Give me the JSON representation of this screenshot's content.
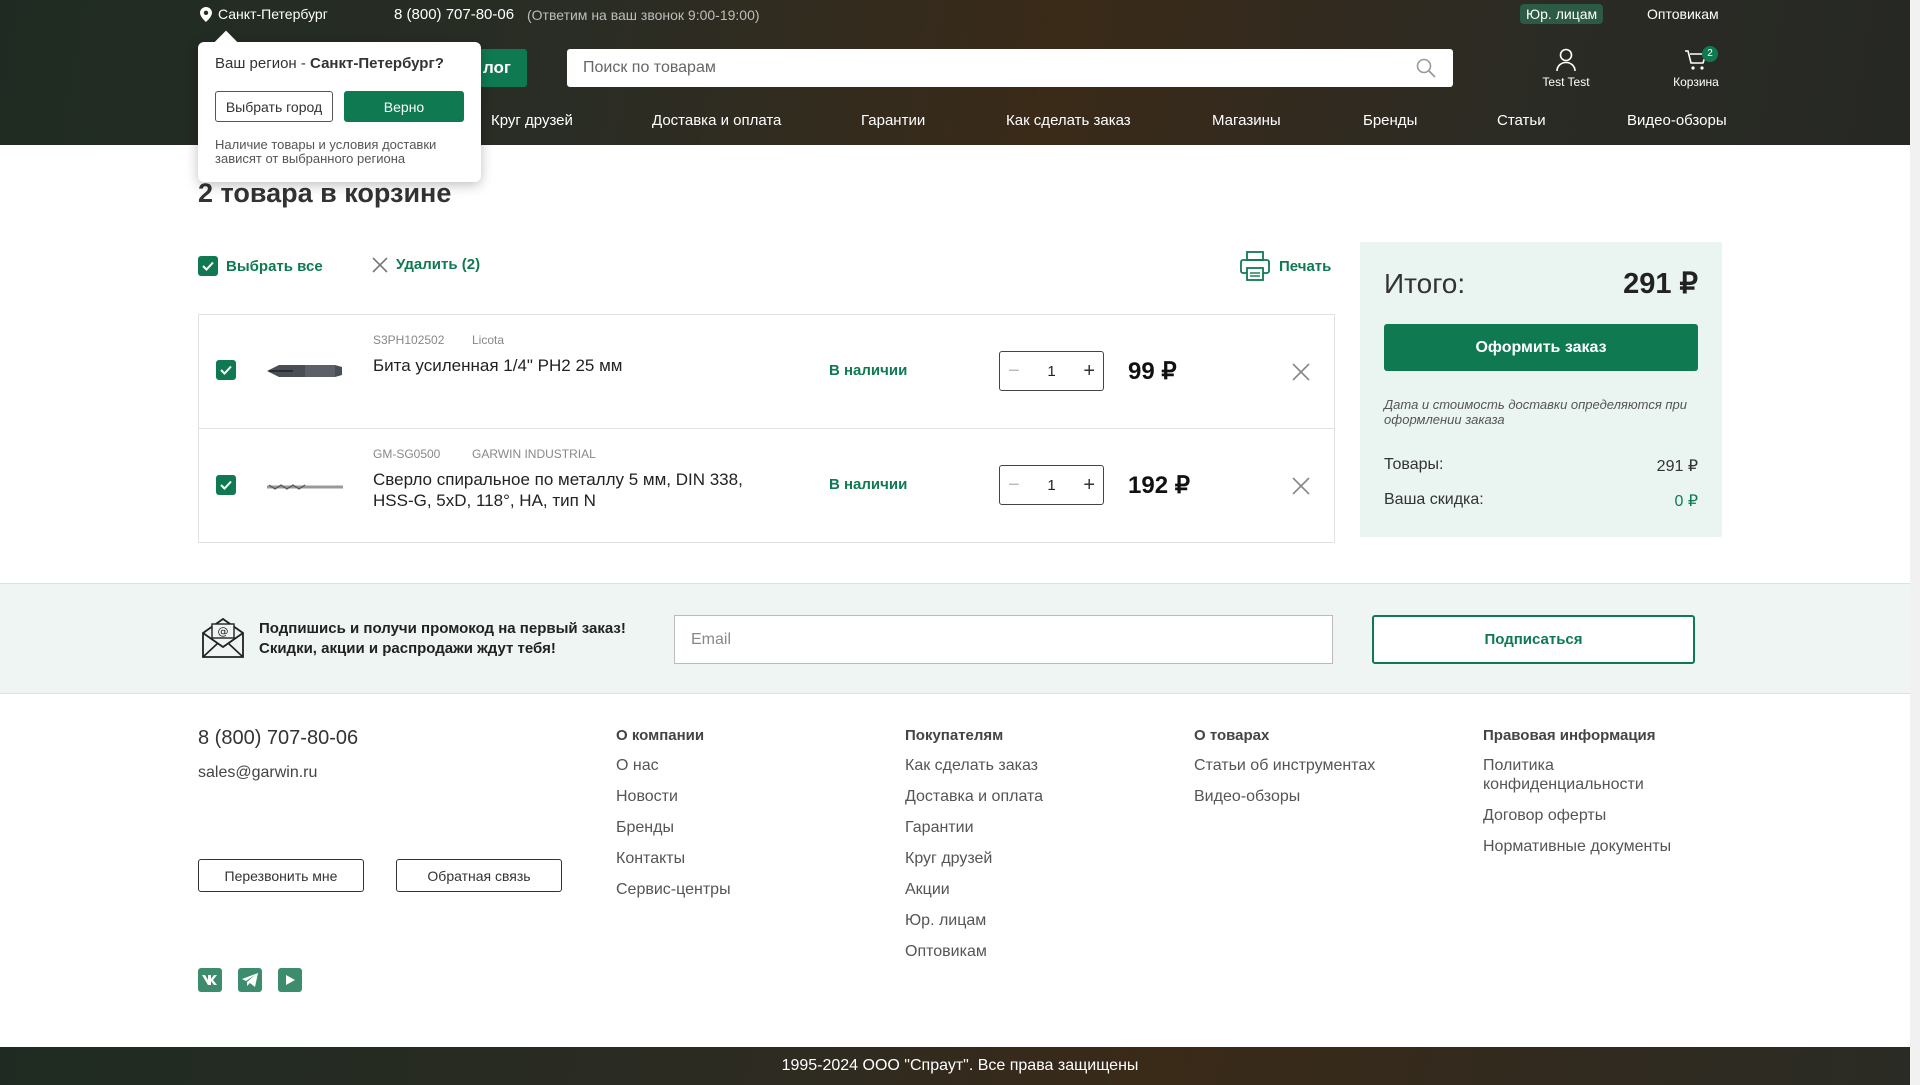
{
  "header": {
    "city": "Санкт-Петербург",
    "phone": "8 (800) 707-80-06",
    "phone_note": "(Ответим на ваш звонок 9:00-19:00)",
    "jur": "Юр. лицам",
    "wholesale": "Оптовикам",
    "catalog": "лог",
    "search_placeholder": "Поиск по товарам",
    "user_label": "Test Test",
    "cart_label": "Корзина",
    "cart_count": "2",
    "nav": [
      "Круг друзей",
      "Доставка и оплата",
      "Гарантии",
      "Как сделать заказ",
      "Магазины",
      "Бренды",
      "Статьи",
      "Видео-обзоры"
    ]
  },
  "region_popup": {
    "question_prefix": "Ваш регион - ",
    "question_city": "Санкт-Петербург?",
    "choose_btn": "Выбрать город",
    "ok_btn": "Верно",
    "note": "Наличие товары и условия доставки зависят от выбранного региона"
  },
  "cart": {
    "title": "2 товара в корзине",
    "select_all": "Выбрать все",
    "delete": "Удалить (2)",
    "print": "Печать",
    "items": [
      {
        "sku": "S3PH102502",
        "brand": "Licota",
        "name": "Бита усиленная 1/4\" PH2 25 мм",
        "stock": "В наличии",
        "qty": "1",
        "price": "99 ₽"
      },
      {
        "sku": "GM-SG0500",
        "brand": "GARWIN INDUSTRIAL",
        "name": "Сверло спиральное по металлу 5 мм, DIN 338, HSS-G, 5xD, 118°, HA, тип N",
        "stock": "В наличии",
        "qty": "1",
        "price": "192 ₽"
      }
    ]
  },
  "summary": {
    "label": "Итого:",
    "total": "291 ₽",
    "order_btn": "Оформить заказ",
    "note": "Дата и стоимость доставки определяются при оформлении заказа",
    "goods_label": "Товары:",
    "goods_value": "291 ₽",
    "discount_label": "Ваша скидка:",
    "discount_value": "0 ₽"
  },
  "subscribe": {
    "line1": "Подпишись и получи промокод на первый заказ!",
    "line2": "Скидки, акции и распродажи ждут тебя!",
    "email_placeholder": "Email",
    "button": "Подписаться"
  },
  "footer": {
    "phone": "8 (800) 707-80-06",
    "email": "sales@garwin.ru",
    "callback_btn": "Перезвонить мне",
    "feedback_btn": "Обратная связь",
    "columns": [
      {
        "title": "О компании",
        "links": [
          "О нас",
          "Новости",
          "Бренды",
          "Контакты",
          "Сервис-центры"
        ]
      },
      {
        "title": "Покупателям",
        "links": [
          "Как сделать заказ",
          "Доставка и оплата",
          "Гарантии",
          "Круг друзей",
          "Акции",
          "Юр. лицам",
          "Оптовикам"
        ]
      },
      {
        "title": "О товарах",
        "links": [
          "Статьи об инструментах",
          "Видео-обзоры"
        ]
      },
      {
        "title": "Правовая информация",
        "links": [
          "Политика конфиденциальности",
          "Договор оферты",
          "Нормативные документы"
        ]
      }
    ],
    "copyright": "1995-2024 ООО \"Спраут\". Все права защищены"
  },
  "colors": {
    "accent": "#0f7a52",
    "summary_bg": "#eaf4f0",
    "header_dark": "#2a2d25"
  }
}
